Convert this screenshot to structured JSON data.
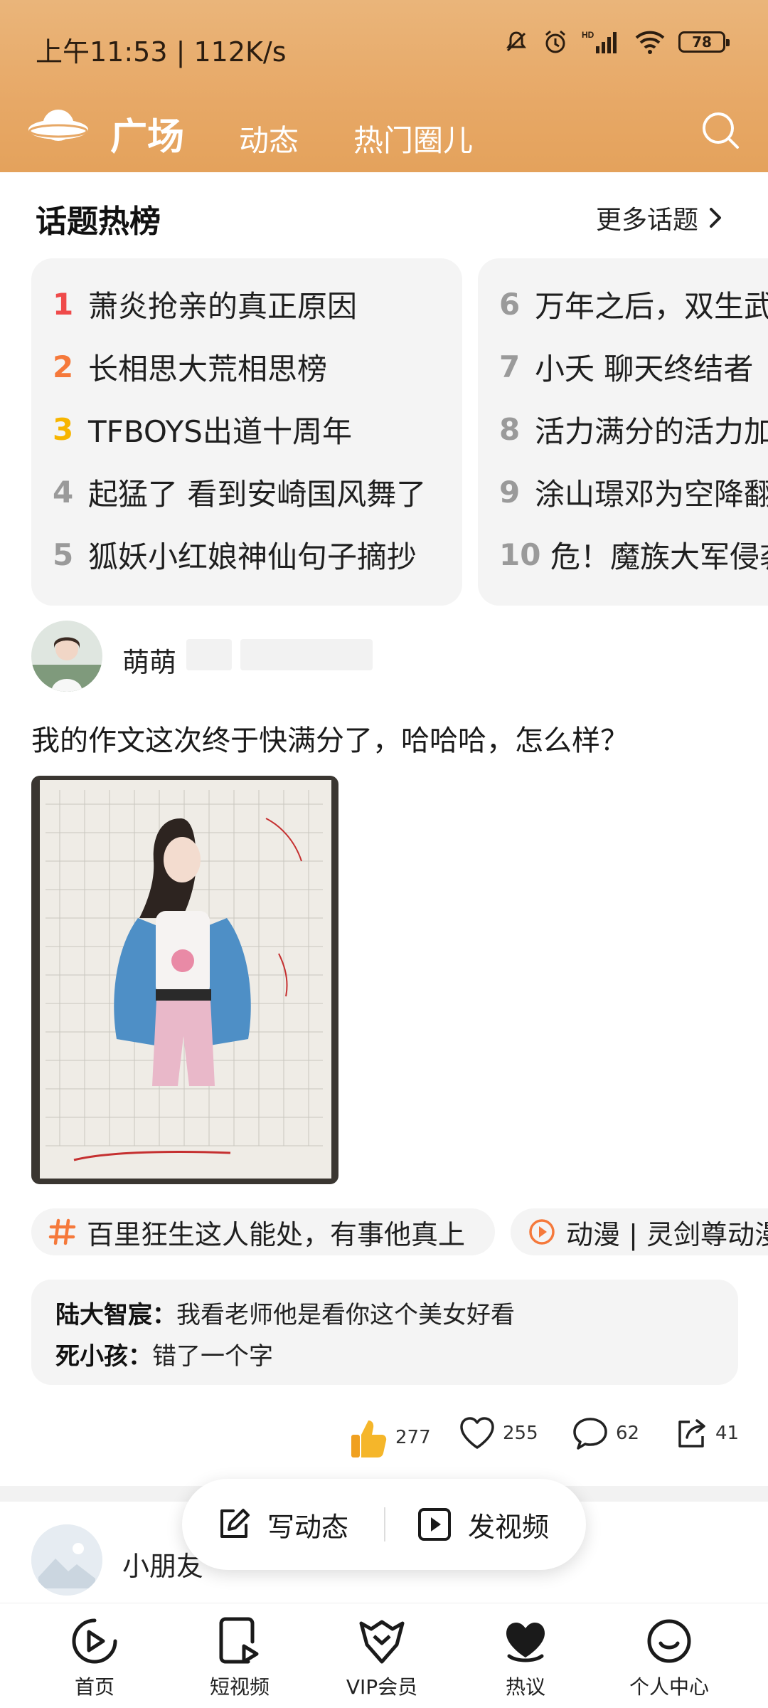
{
  "status": {
    "time": "上午11:53 | 112K/s",
    "battery": "78",
    "network": "HD"
  },
  "nav": {
    "tabs": [
      {
        "label": "广场"
      },
      {
        "label": "动态"
      },
      {
        "label": "热门圈儿"
      }
    ]
  },
  "hot_topics": {
    "title": "话题热榜",
    "more_label": "更多话题",
    "list1": [
      {
        "rank": "1",
        "text": "萧炎抢亲的真正原因",
        "color": "#ef4a4a"
      },
      {
        "rank": "2",
        "text": "长相思大荒相思榜",
        "color": "#f5793b"
      },
      {
        "rank": "3",
        "text": "TFBOYS出道十周年",
        "color": "#f7b500"
      },
      {
        "rank": "4",
        "text": "起猛了 看到安崎国风舞了",
        "color": "#a0a0a0"
      },
      {
        "rank": "5",
        "text": "狐妖小红娘神仙句子摘抄",
        "color": "#a0a0a0"
      }
    ],
    "list2": [
      {
        "rank": "6",
        "text": "万年之后，双生武魂",
        "color": "#a0a0a0"
      },
      {
        "rank": "7",
        "text": "小夭 聊天终结者",
        "color": "#a0a0a0"
      },
      {
        "rank": "8",
        "text": "活力满分的活力加油站",
        "color": "#a0a0a0"
      },
      {
        "rank": "9",
        "text": "涂山璟邓为空降翻拍",
        "color": "#a0a0a0"
      },
      {
        "rank": "10",
        "text": "危！魔族大军侵袭",
        "color": "#a0a0a0"
      }
    ]
  },
  "post": {
    "username": "萌萌",
    "text": "我的作文这次终于快满分了，哈哈哈，怎么样？",
    "tags": [
      {
        "icon": "hashtag-icon",
        "text": "百里狂生这人能处，有事他真上"
      },
      {
        "icon": "play-circle-icon",
        "text": "动漫 | 灵剑尊动漫"
      }
    ],
    "comments": [
      {
        "user": "陆大智宸：",
        "text": "我看老师他是看你这个美女好看"
      },
      {
        "user": "死小孩：",
        "text": "错了一个字"
      }
    ],
    "stats": {
      "likes": "277",
      "favorites": "255",
      "comments": "62",
      "shares": "41"
    }
  },
  "next_post": {
    "username": "小朋友"
  },
  "compose": {
    "write_label": "写动态",
    "video_label": "发视频"
  },
  "bottom_nav": [
    {
      "label": "首页"
    },
    {
      "label": "短视频"
    },
    {
      "label": "VIP会员"
    },
    {
      "label": "热议"
    },
    {
      "label": "个人中心"
    }
  ],
  "colors": {
    "accent": "#f5a24a",
    "header": "#e7a866",
    "tag_icon": "#f5793b"
  }
}
